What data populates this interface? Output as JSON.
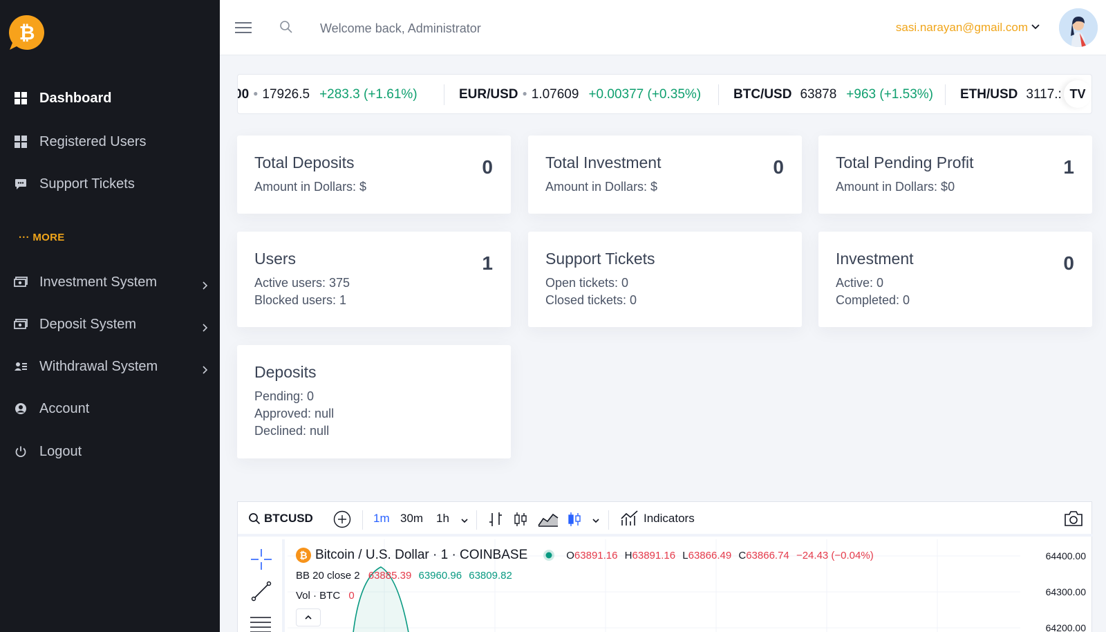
{
  "sidebar": {
    "items": [
      {
        "label": "Dashboard"
      },
      {
        "label": "Registered Users"
      },
      {
        "label": "Support Tickets"
      },
      {
        "label": "Investment System"
      },
      {
        "label": "Deposit System"
      },
      {
        "label": "Withdrawal System"
      },
      {
        "label": "Account"
      },
      {
        "label": "Logout"
      }
    ],
    "more_label": "MORE"
  },
  "header": {
    "welcome": "Welcome back, Administrator",
    "email": "sasi.narayan@gmail.com"
  },
  "ticker": [
    {
      "symbol": "00",
      "price": "17926.5",
      "change": "+283.3 (+1.61%)"
    },
    {
      "symbol": "EUR/USD",
      "price": "1.07609",
      "change": "+0.00377 (+0.35%)"
    },
    {
      "symbol": "BTC/USD",
      "price": "63878",
      "change": "+963 (+1.53%)"
    },
    {
      "symbol": "ETH/USD",
      "price": "3117.:"
    }
  ],
  "ticker_logo": "TV",
  "cards": {
    "total_deposits": {
      "title": "Total Deposits",
      "value": "0",
      "line1": "Amount in Dollars: $"
    },
    "total_investment": {
      "title": "Total Investment",
      "value": "0",
      "line1": "Amount in Dollars: $"
    },
    "total_pending_profit": {
      "title": "Total Pending Profit",
      "value": "1",
      "line1": "Amount in Dollars: $0"
    },
    "users": {
      "title": "Users",
      "value": "1",
      "line1": "Active users: 375",
      "line2": "Blocked users: 1"
    },
    "support_tickets": {
      "title": "Support Tickets",
      "line1": "Open tickets: 0",
      "line2": "Closed tickets: 0"
    },
    "investment": {
      "title": "Investment",
      "value": "0",
      "line1": "Active: 0",
      "line2": "Completed: 0"
    },
    "deposits": {
      "title": "Deposits",
      "line1": "Pending: 0",
      "line2": "Approved: null",
      "line3": "Declined: null"
    }
  },
  "chart_widget": {
    "symbol": "BTCUSD",
    "intervals": [
      "1m",
      "30m",
      "1h"
    ],
    "indicators_label": "Indicators",
    "title": "Bitcoin / U.S. Dollar · 1 · COINBASE",
    "ohlc": {
      "o_label": "O",
      "o": "63891.16",
      "h_label": "H",
      "h": "63891.16",
      "l_label": "L",
      "l": "63866.49",
      "c_label": "C",
      "c": "63866.74",
      "change": "−24.43 (−0.04%)"
    },
    "bb": {
      "label": "BB 20 close 2",
      "v1": "63885.39",
      "v2": "63960.96",
      "v3": "63809.82"
    },
    "vol": {
      "label": "Vol · BTC",
      "value": "0"
    },
    "price_axis": [
      "64400.00",
      "64300.00",
      "64200.00"
    ]
  },
  "colors": {
    "sidebar_bg": "#17191f",
    "accent": "#f0a51a",
    "up": "#0e9f6e",
    "down": "#e53a4a"
  }
}
